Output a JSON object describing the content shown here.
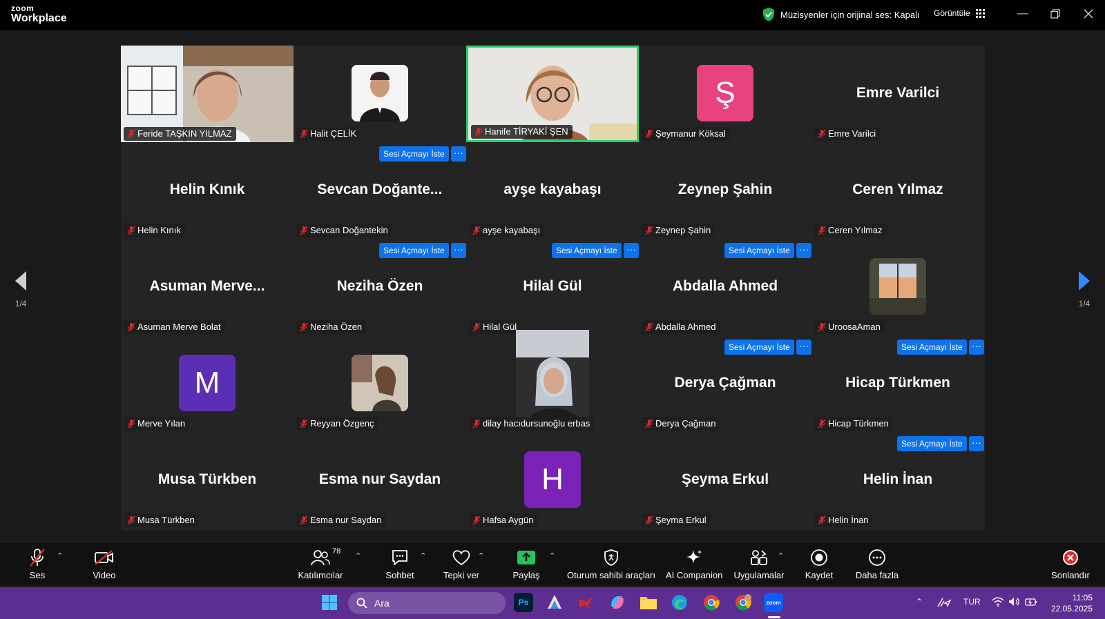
{
  "app": {
    "logo_top": "zoom",
    "logo_bottom": "Workplace"
  },
  "header": {
    "status_text": "Müzisyenler için orijinal ses: Kapalı",
    "view_label": "Görüntüle"
  },
  "colors": {
    "accent": "#0e72ed",
    "active_border": "#2ecc71",
    "muted_mic": "#e02828",
    "taskbar": "#5c2e91"
  },
  "gallery": {
    "page": "1/4",
    "request_unmute_label": "Sesi Açmayı İste",
    "more_label": "···",
    "tiles": [
      {
        "label": "Feride TAŞKIN YILMAZ",
        "display": ""
      },
      {
        "label": "Halit ÇELİK",
        "display": ""
      },
      {
        "label": "Hanife TİRYAKİ ŞEN",
        "display": ""
      },
      {
        "label": "Şeymanur Köksal",
        "display": "",
        "avatar_letter": "Ş"
      },
      {
        "label": "Emre Varilci",
        "display": "Emre Varilci"
      },
      {
        "label": "Helin Kınık",
        "display": "Helin Kınık"
      },
      {
        "label": "Sevcan Doğantekin",
        "display": "Sevcan  Doğante..."
      },
      {
        "label": "ayşe kayabaşı",
        "display": "ayşe kayabaşı"
      },
      {
        "label": "Zeynep Şahin",
        "display": "Zeynep Şahin"
      },
      {
        "label": "Ceren Yılmaz",
        "display": "Ceren Yılmaz"
      },
      {
        "label": "Asuman Merve Bolat",
        "display": "Asuman  Merve..."
      },
      {
        "label": "Neziha Özen",
        "display": "Neziha Özen"
      },
      {
        "label": "Hilal Gül",
        "display": "Hilal Gül"
      },
      {
        "label": "Abdalla Ahmed",
        "display": "Abdalla Ahmed"
      },
      {
        "label": "UroosaAman",
        "display": ""
      },
      {
        "label": "Merve Yılan",
        "display": "",
        "avatar_letter": "M"
      },
      {
        "label": "Reyyan Özgenç",
        "display": ""
      },
      {
        "label": "dilay hacıdursunoğlu erbas",
        "display": ""
      },
      {
        "label": "Derya Çağman",
        "display": "Derya Çağman"
      },
      {
        "label": "Hicap Türkmen",
        "display": "Hicap Türkmen"
      },
      {
        "label": "Musa Türkben",
        "display": "Musa Türkben"
      },
      {
        "label": "Esma nur Saydan",
        "display": "Esma nur Saydan"
      },
      {
        "label": "Hafsa Aygün",
        "display": "",
        "avatar_letter": "H"
      },
      {
        "label": "Şeyma Erkul",
        "display": "Şeyma Erkul"
      },
      {
        "label": "Helin İnan",
        "display": "Helin İnan"
      }
    ]
  },
  "toolbar": {
    "audio": "Ses",
    "video": "Video",
    "participants": "Katılımcılar",
    "participants_count": "78",
    "chat": "Sohbet",
    "reactions": "Tepki ver",
    "share": "Paylaş",
    "host_tools": "Oturum sahibi araçları",
    "ai_companion": "AI Companion",
    "apps": "Uygulamalar",
    "record": "Kaydet",
    "more": "Daha fazla",
    "end": "Sonlandır"
  },
  "taskbar": {
    "search_placeholder": "Ara",
    "lang": "TUR",
    "time": "11:05",
    "date": "22.05.2025",
    "apps": [
      "start",
      "photoshop",
      "calendar",
      "bird",
      "copilot",
      "file-explorer",
      "edge",
      "chrome",
      "chrome-profile",
      "zoom"
    ]
  }
}
